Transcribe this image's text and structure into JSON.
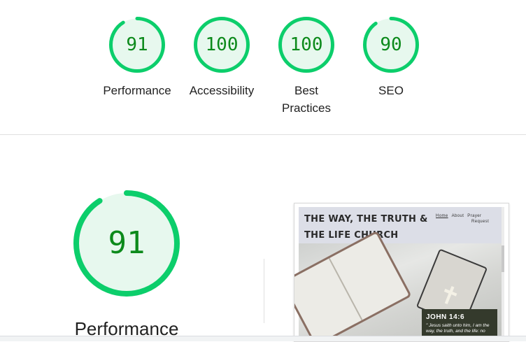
{
  "summary": {
    "gauges": [
      {
        "score": "91",
        "label": "Performance",
        "value": 0.91
      },
      {
        "score": "100",
        "label": "Accessibility",
        "value": 1.0
      },
      {
        "score": "100",
        "label": "Best Practices",
        "value": 1.0
      },
      {
        "score": "90",
        "label": "SEO",
        "value": 0.9
      }
    ]
  },
  "detail": {
    "score": "91",
    "value": 0.91,
    "label": "Performance"
  },
  "screenshot": {
    "site_title": "THE WAY, THE TRUTH & THE LIFE CHURCH",
    "nav": {
      "home": "Home",
      "about": "About",
      "prayer": "Prayer",
      "request": "Request"
    },
    "verse_ref": "JOHN 14:6",
    "verse_text": "\" Jesus saith unto him, I am the way, the truth, and the life: no"
  },
  "colors": {
    "pass": "#0cce6b",
    "pass_fill": "#e7f8ee",
    "pass_text": "#0c8a1b"
  }
}
